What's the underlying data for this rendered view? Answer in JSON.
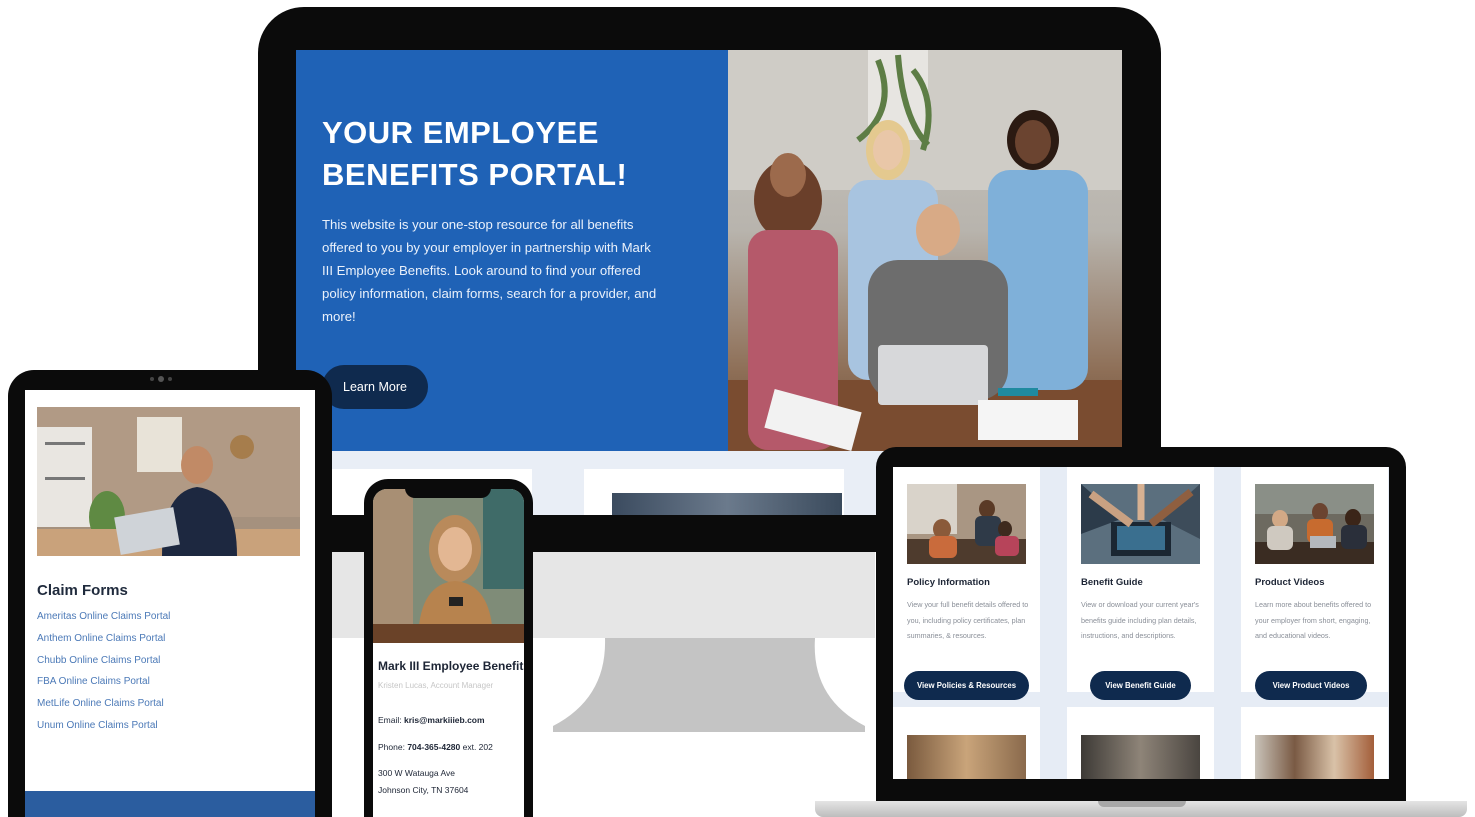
{
  "desktop": {
    "hero": {
      "title_line1": "YOUR EMPLOYEE",
      "title_line2": "BENEFITS PORTAL!",
      "description": "This website is your one-stop resource for all benefits offered to you by your employer in partnership with Mark III Employee Benefits.  Look around to find your offered policy information, claim forms, search for a provider, and more!",
      "button_label": "Learn More"
    },
    "colors": {
      "hero_blue": "#1f62b6",
      "button_navy": "#0f2a4e"
    }
  },
  "tablet": {
    "heading": "Claim Forms",
    "links": [
      "Ameritas Online Claims Portal",
      "Anthem Online Claims Portal",
      "Chubb Online Claims Portal",
      "FBA Online Claims Portal",
      "MetLife Online Claims Portal",
      "Unum Online Claims Portal"
    ],
    "colors": {
      "link": "#4b79b7",
      "footer_bar": "#2b5d9f"
    }
  },
  "phone": {
    "name": "Mark III Employee Benefits",
    "subtitle": "Kristen Lucas, Account Manager",
    "email_label": "Email: ",
    "email": "kris@markiiieb.com",
    "phone_label": "Phone: ",
    "phone_number": "704-365-4280",
    "phone_ext": " ext. 202",
    "address_line1": "300 W Watauga Ave",
    "address_line2": "Johnson City, TN 37604"
  },
  "laptop": {
    "cards": [
      {
        "title": "Policy Information",
        "description": "View your full benefit details offered to you, including policy certificates, plan summaries, & resources.",
        "button_label": "View Policies & Resources"
      },
      {
        "title": "Benefit Guide",
        "description": "View or download your current year's benefits guide including plan details, instructions, and descriptions.",
        "button_label": "View Benefit Guide"
      },
      {
        "title": "Product Videos",
        "description": "Learn more about benefits offered to your employer from short, engaging, and educational videos.",
        "button_label": "View Product Videos"
      }
    ]
  }
}
